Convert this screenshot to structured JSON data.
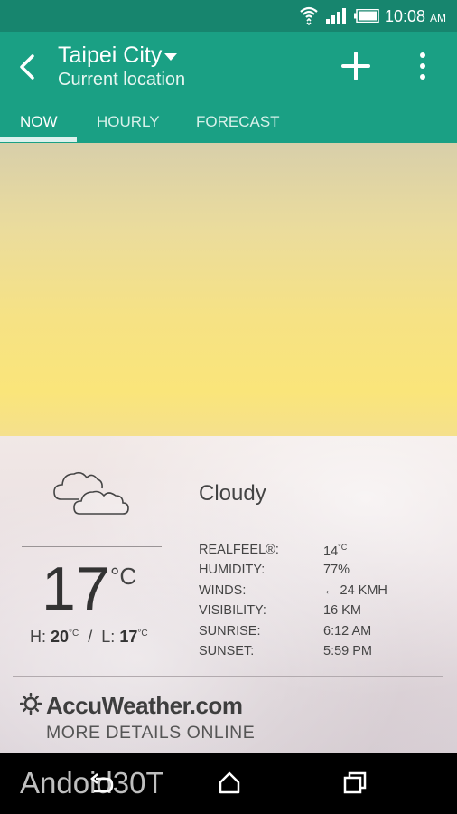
{
  "status_bar": {
    "time": "10:08",
    "ampm": "AM"
  },
  "header": {
    "city": "Taipei City",
    "subtitle": "Current location",
    "tabs": [
      {
        "label": "NOW",
        "active": true
      },
      {
        "label": "HOURLY",
        "active": false
      },
      {
        "label": "FORECAST",
        "active": false
      }
    ]
  },
  "current": {
    "icon": "cloudy-icon",
    "condition": "Cloudy",
    "temperature": "17",
    "unit": "°C",
    "high_label": "H:",
    "high": "20",
    "low_label": "L:",
    "low": "17",
    "deg_c": "°C",
    "details": [
      {
        "label": "REALFEEL®:",
        "value": "14",
        "sup": "°C"
      },
      {
        "label": "HUMIDITY:",
        "value": "77%"
      },
      {
        "label": "WINDS:",
        "value": "← 24 KMH"
      },
      {
        "label": "VISIBILITY:",
        "value": "16 KM"
      },
      {
        "label": "SUNRISE:",
        "value": "6:12 AM"
      },
      {
        "label": "SUNSET:",
        "value": "5:59 PM"
      }
    ]
  },
  "footer": {
    "provider": "AccuWeather.com",
    "more_details": "MORE DETAILS ONLINE"
  },
  "watermark": "Andoid30T",
  "colors": {
    "status_bar": "#17856e",
    "app_bar": "#1aa084",
    "nav_bar": "#000000"
  }
}
